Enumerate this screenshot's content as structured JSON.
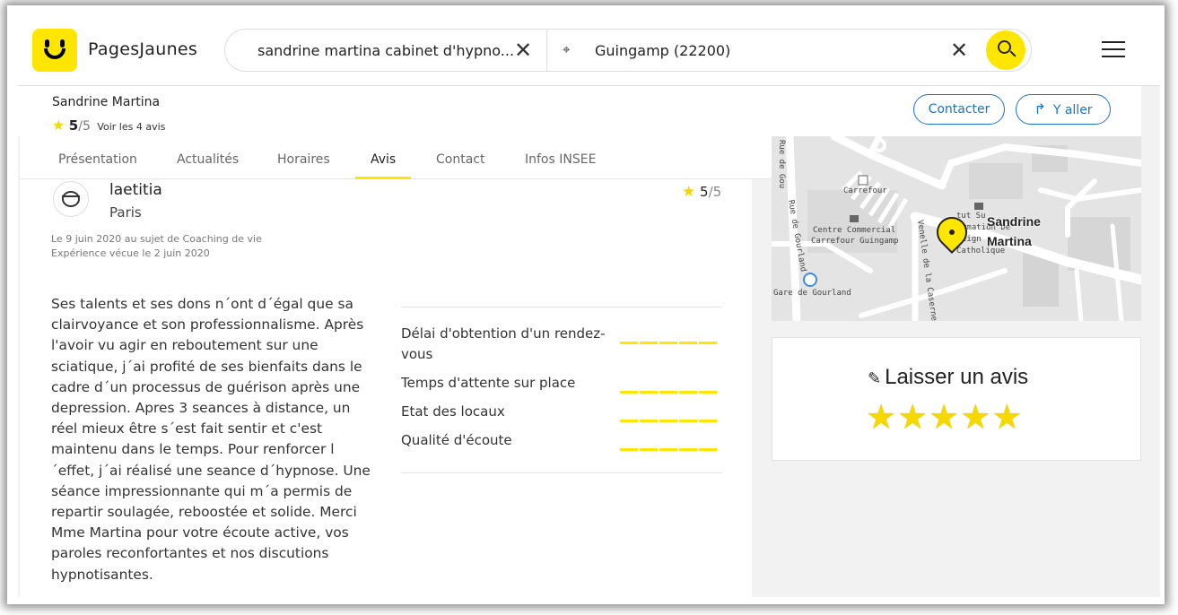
{
  "header": {
    "logo_text": "PagesJaunes",
    "search_what": "sandrine martina cabinet d'hypno...",
    "search_where": "Guingamp (22200)"
  },
  "business": {
    "name": "Sandrine Martina",
    "rating_value": "5",
    "rating_outof": "/5",
    "reviews_link": "Voir les 4 avis",
    "contact_label": "Contacter",
    "go_label": "Y aller"
  },
  "tabs": [
    {
      "label": "Présentation"
    },
    {
      "label": "Actualités"
    },
    {
      "label": "Horaires"
    },
    {
      "label": "Avis"
    },
    {
      "label": "Contact"
    },
    {
      "label": "Infos INSEE"
    }
  ],
  "review": {
    "author": "laetitia",
    "city": "Paris",
    "score": "5",
    "score_outof": "/5",
    "date_line": "Le 9 juin 2020 au sujet de Coaching de vie",
    "experience_line": "Expérience vécue le 2 juin 2020",
    "text": "Ses talents et ses dons n´ont d´égal que sa clairvoyance et son professionnalisme. Après l'avoir vu agir en reboutement sur une sciatique, j´ai profité de ses bienfaits dans le cadre d´un processus de guérison après une depression. Apres 3 seances à distance, un réel mieux être s´est fait sentir et c'est maintenu dans le temps. Pour renforcer l´effet, j´ai réalisé une seance d´hypnose. Une séance impressionnante qui m´a permis de repartir soulagée, reboostée et solide. Merci Mme Martina pour votre écoute active, vos paroles reconfortantes et nos discutions hypnotisantes.",
    "criteria": [
      {
        "label": "Délai d'obtention d'un rendez-vous",
        "stars": 5
      },
      {
        "label": "Temps d'attente sur place",
        "stars": 5
      },
      {
        "label": "Etat des locaux",
        "stars": 5
      },
      {
        "label": "Qualité d'écoute",
        "stars": 5
      }
    ]
  },
  "map": {
    "labels": {
      "carrefour": "Carrefour",
      "centre_commercial": "Centre Commercial",
      "carrefour_guingamp": "Carrefour Guingamp",
      "gare": "Gare de Gourland",
      "rue_gourland": "Rue de Gourland",
      "rue_de_gou": "Rue de Gou",
      "venelle": "Venelle de la Caserne",
      "institut1": "tut Su",
      "institut2": "rmation De",
      "institut3": "eign",
      "institut4": "Catholique",
      "poi_line1": "Sandrine",
      "poi_line2": "Martina"
    }
  },
  "leave_review": {
    "title": "Laisser un avis",
    "stars": 5
  },
  "colors": {
    "brand_yellow": "#ffe600",
    "link_blue": "#1a73c8"
  }
}
